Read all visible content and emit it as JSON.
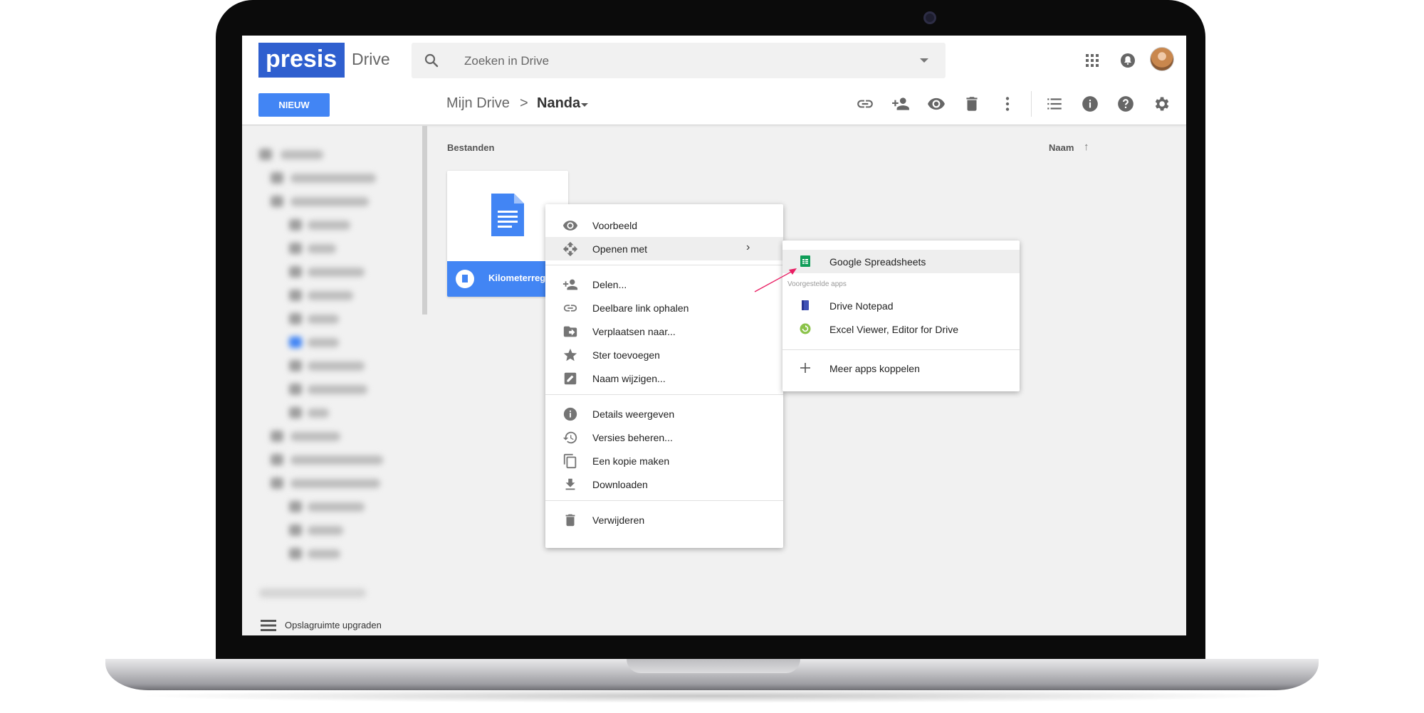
{
  "app": {
    "brand": "presis",
    "product": "Drive"
  },
  "search": {
    "placeholder": "Zoeken in Drive"
  },
  "toolbar": {
    "new_label": "NIEUW",
    "breadcrumb_root": "Mijn Drive",
    "breadcrumb_separator": ">",
    "breadcrumb_current": "Nanda"
  },
  "main": {
    "section_label": "Bestanden",
    "sort_label": "Naam",
    "sort_arrow": "↑",
    "file": {
      "name": "Kilometerreg"
    }
  },
  "context_menu": {
    "preview": "Voorbeeld",
    "open_with": "Openen met",
    "open_with_arrow": "›",
    "share": "Delen...",
    "get_link": "Deelbare link ophalen",
    "move_to": "Verplaatsen naar...",
    "add_star": "Ster toevoegen",
    "rename": "Naam wijzigen...",
    "details": "Details weergeven",
    "versions": "Versies beheren...",
    "copy": "Een kopie maken",
    "download": "Downloaden",
    "delete": "Verwijderen"
  },
  "submenu": {
    "primary_app": "Google Spreadsheets",
    "section_label": "Voorgestelde apps",
    "app_notepad": "Drive Notepad",
    "app_excel": "Excel Viewer, Editor for Drive",
    "connect_more": "Meer apps koppelen"
  },
  "sidebar": {
    "upgrade_label": "Opslagruimte upgraden"
  },
  "colors": {
    "brand": "#2f5fcf",
    "accent": "#4285f4",
    "sheets_green": "#0f9d58",
    "pointer_pink": "#e91e63"
  }
}
